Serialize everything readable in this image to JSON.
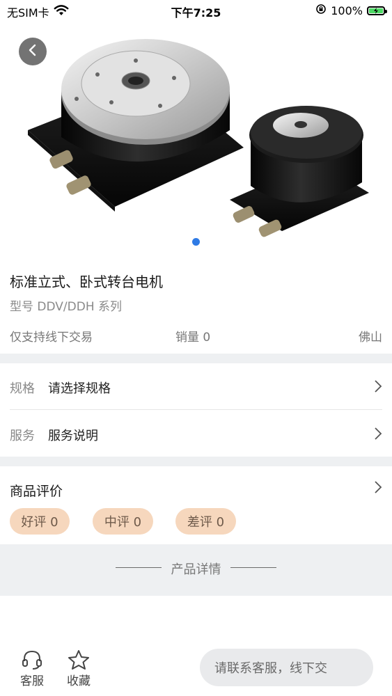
{
  "status_bar": {
    "carrier": "无SIM卡",
    "time": "下午7:25",
    "battery": "100%"
  },
  "product": {
    "title": "标准立式、卧式转台电机",
    "model": "型号 DDV/DDH 系列",
    "trade_note": "仅支持线下交易",
    "sales": "销量 0",
    "location": "佛山"
  },
  "options": [
    {
      "label": "规格",
      "value": "请选择规格"
    },
    {
      "label": "服务",
      "value": "服务说明"
    }
  ],
  "reviews": {
    "title": "商品评价",
    "tags": [
      "好评 0",
      "中评 0",
      "差评 0"
    ]
  },
  "detail": {
    "label": "产品详情"
  },
  "tabbar": {
    "service_label": "客服",
    "favorite_label": "收藏",
    "contact_label": "请联系客服，线下交"
  },
  "colors": {
    "accent": "#2f7be5",
    "tag_bg": "#f6d7bd",
    "section_bg": "#eef0f2"
  },
  "icons": [
    "wifi-icon",
    "back-icon",
    "chevron-right-icon",
    "headset-icon",
    "star-icon",
    "orientation-lock-icon",
    "charging-icon"
  ]
}
